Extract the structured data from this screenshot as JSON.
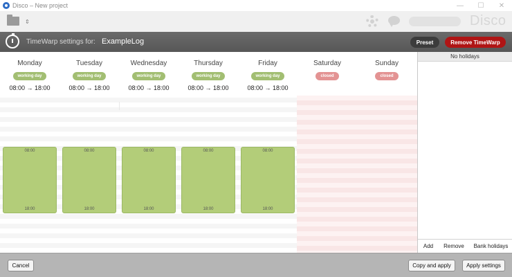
{
  "window": {
    "title": "Disco – New project",
    "controls": [
      "—",
      "☐",
      "✕"
    ]
  },
  "toolbar": {
    "brand": "Disco",
    "folder_arrow": "⇕",
    "icons": [
      "folder-icon",
      "gear-icon",
      "chat-icon"
    ]
  },
  "header": {
    "label": "TimeWarp settings for:",
    "log_name": "ExampleLog",
    "preset_label": "Preset",
    "remove_label": "Remove TimeWarp",
    "remove_color": "#b01515"
  },
  "days": [
    {
      "name": "Monday",
      "status": "working day",
      "hours": "08:00 → 18:00",
      "start": "08:00",
      "end": "18:00"
    },
    {
      "name": "Tuesday",
      "status": "working day",
      "hours": "08:00 → 18:00",
      "start": "08:00",
      "end": "18:00"
    },
    {
      "name": "Wednesday",
      "status": "working day",
      "hours": "08:00 → 18:00",
      "start": "08:00",
      "end": "18:00"
    },
    {
      "name": "Thursday",
      "status": "working day",
      "hours": "08:00 → 18:00",
      "start": "08:00",
      "end": "18:00"
    },
    {
      "name": "Friday",
      "status": "working day",
      "hours": "08:00 → 18:00",
      "start": "08:00",
      "end": "18:00"
    },
    {
      "name": "Saturday",
      "status": "closed"
    },
    {
      "name": "Sunday",
      "status": "closed"
    }
  ],
  "colors": {
    "working": "#a2be72",
    "closed": "#e39393",
    "block": "#b3cd79"
  },
  "holidays": {
    "empty_label": "No holidays",
    "add_label": "Add",
    "remove_label": "Remove",
    "bank_label": "Bank holidays"
  },
  "footer": {
    "cancel_label": "Cancel",
    "copy_apply_label": "Copy and apply",
    "apply_label": "Apply settings"
  }
}
